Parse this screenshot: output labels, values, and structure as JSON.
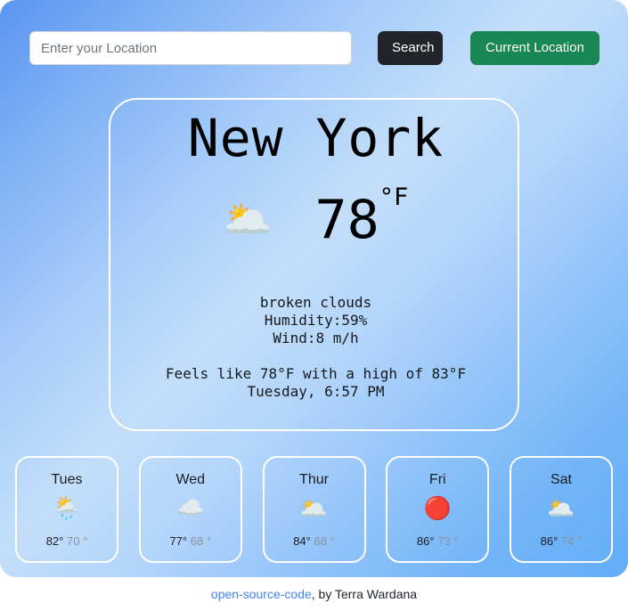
{
  "search": {
    "placeholder": "Enter your Location",
    "value": "",
    "search_label": "Search",
    "current_location_label": "Current Location"
  },
  "current": {
    "city": "New York",
    "temperature": "78",
    "unit": "°F",
    "icon": "broken-clouds",
    "icon_glyph": "🌥️",
    "description": "broken clouds",
    "humidity_line": "Humidity:59%",
    "wind_line": "Wind:8 m/h",
    "feels_like_line": "Feels like 78°F with a high of 83°F",
    "time_line": "Tuesday, 6:57 PM"
  },
  "forecast": [
    {
      "day": "Tues",
      "icon": "sun-behind-rain-cloud",
      "icon_glyph": "🌦️",
      "high": "82°",
      "low": "70 °"
    },
    {
      "day": "Wed",
      "icon": "cloud",
      "icon_glyph": "☁️",
      "high": "77°",
      "low": "68 °"
    },
    {
      "day": "Thur",
      "icon": "broken-clouds",
      "icon_glyph": "🌥️",
      "high": "84°",
      "low": "68 °"
    },
    {
      "day": "Fri",
      "icon": "sun",
      "icon_glyph": "🔴",
      "high": "86°",
      "low": "73 °"
    },
    {
      "day": "Sat",
      "icon": "broken-clouds",
      "icon_glyph": "🌥️",
      "high": "86°",
      "low": "74 °"
    }
  ],
  "footer": {
    "link_label": "open-source-code",
    "credit": ", by Terra Wardana"
  },
  "colors": {
    "search_button": "#212529",
    "current_location_button": "#198754",
    "link": "#4285f4",
    "sky_top_left": "#5b95f0",
    "sky_center": "#c3def9",
    "sky_bottom_right": "#63aef7"
  }
}
